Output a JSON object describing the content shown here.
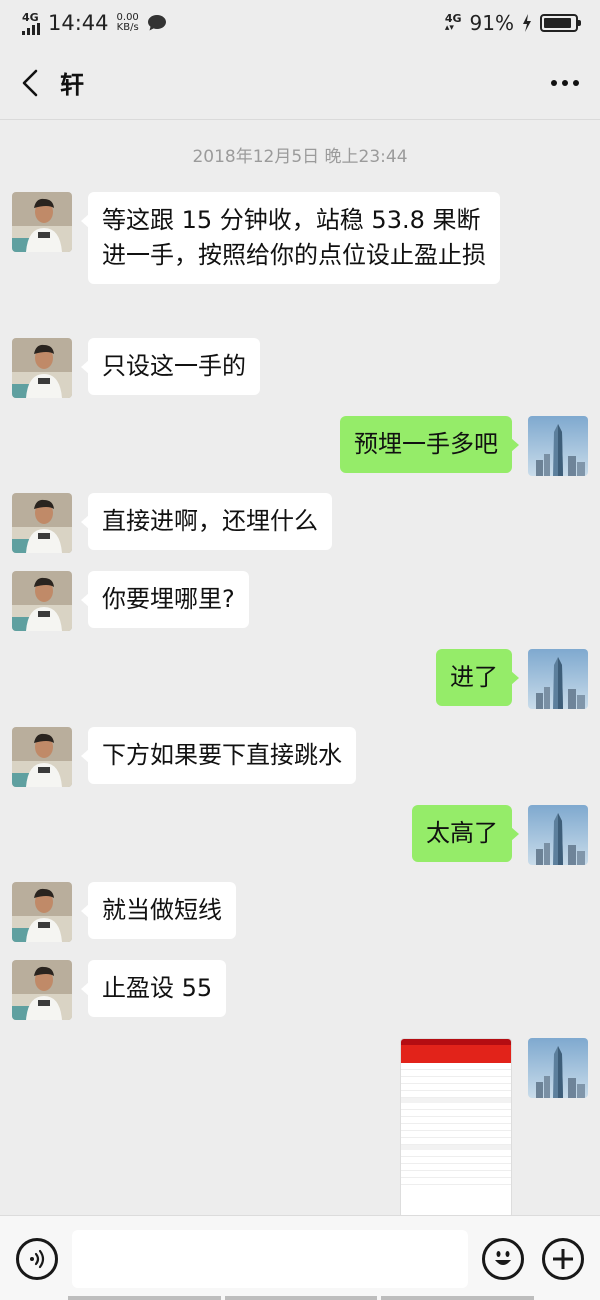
{
  "status_bar": {
    "network": "4G",
    "time": "14:44",
    "speed_value": "0.00",
    "speed_unit": "KB/s",
    "network_right": "4G",
    "battery_percent": "91%",
    "battery_level": 0.91
  },
  "header": {
    "title": "轩"
  },
  "chat": {
    "timestamp": "2018年12月5日 晚上23:44",
    "messages": [
      {
        "side": "left",
        "text": "等这跟 15 分钟收，站稳 53.8 果断进一手，按照给你的点位设止盈止损"
      },
      {
        "side": "left",
        "text": "只设这一手的"
      },
      {
        "side": "right",
        "text": "预埋一手多吧"
      },
      {
        "side": "left",
        "text": "直接进啊，还埋什么"
      },
      {
        "side": "left",
        "text": "你要埋哪里?"
      },
      {
        "side": "right",
        "text": "进了"
      },
      {
        "side": "left",
        "text": "下方如果要下直接跳水"
      },
      {
        "side": "right",
        "text": "太高了"
      },
      {
        "side": "left",
        "text": "就当做短线"
      },
      {
        "side": "left",
        "text": "止盈设 55"
      }
    ]
  },
  "colors": {
    "background": "#EDEDED",
    "bubble_left": "#FFFFFF",
    "bubble_right": "#95EC69",
    "timestamp": "#9B9B9B"
  }
}
